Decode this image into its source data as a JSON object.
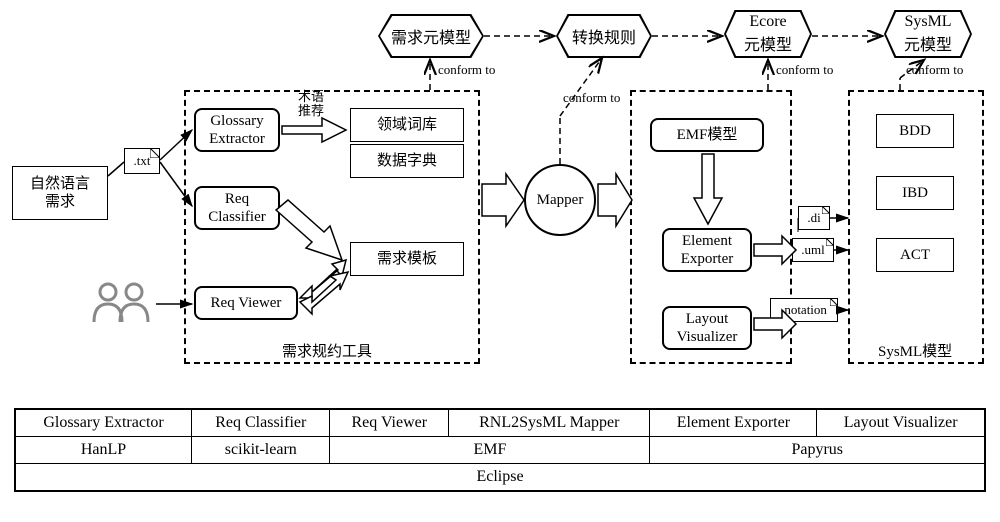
{
  "top": {
    "req_meta": "需求元模型",
    "trans_rule": "转换规则",
    "ecore_meta_l1": "Ecore",
    "ecore_meta_l2": "元模型",
    "sysml_meta_l1": "SysML",
    "sysml_meta_l2": "元模型",
    "conform1": "conform to",
    "conform2": "conform to",
    "conform3": "conform to",
    "conform4": "conform to"
  },
  "left": {
    "nl_req_l1": "自然语言",
    "nl_req_l2": "需求",
    "txt_ext": ".txt"
  },
  "reqspec": {
    "glossary_extractor": "Glossary\nExtractor",
    "req_classifier": "Req\nClassifier",
    "req_viewer": "Req Viewer",
    "term_rec": "术语\n推荐",
    "domain_lexicon": "领域词库",
    "data_dict": "数据字典",
    "req_template": "需求模板",
    "caption": "需求规约工具"
  },
  "mapper": "Mapper",
  "emf": {
    "emf_model": "EMF模型",
    "element_exporter": "Element\nExporter",
    "layout_visualizer": "Layout\nVisualizer"
  },
  "files": {
    "di": ".di",
    "uml": ".uml",
    "notation": ".notation"
  },
  "sysml": {
    "bdd": "BDD",
    "ibd": "IBD",
    "act": "ACT",
    "caption": "SysML模型"
  },
  "table": {
    "r1c1": "Glossary Extractor",
    "r1c2": "Req Classifier",
    "r1c3": "Req Viewer",
    "r1c4": "RNL2SysML Mapper",
    "r1c5": "Element Exporter",
    "r1c6": "Layout Visualizer",
    "r2c1": "HanLP",
    "r2c2": "scikit-learn",
    "r2c34": "EMF",
    "r2c56": "Papyrus",
    "r3": "Eclipse"
  }
}
